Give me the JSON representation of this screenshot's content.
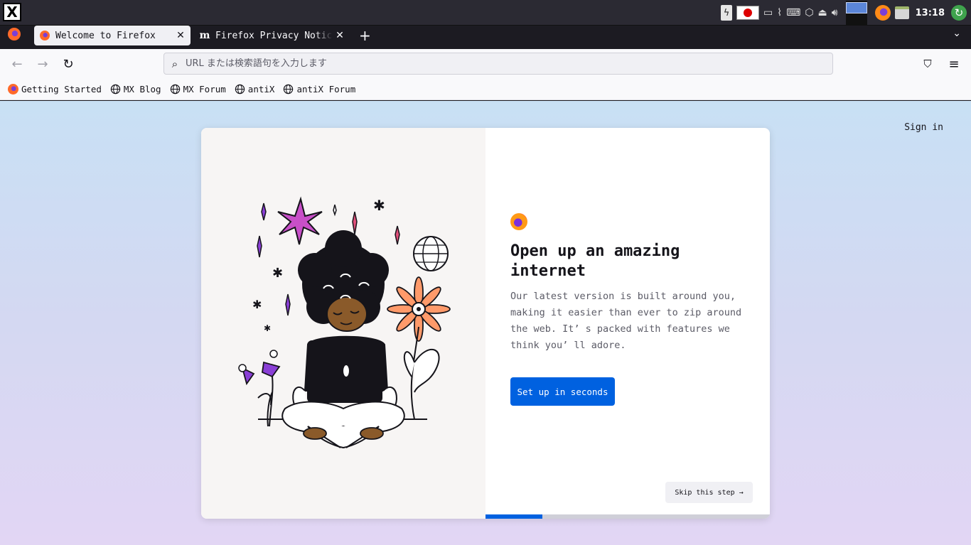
{
  "taskbar": {
    "logo_glyph": "X",
    "clock": "13:18",
    "tray_icons": [
      "power-icon",
      "flag-icon",
      "window-icon",
      "clip-icon",
      "keyboard-icon",
      "box-icon",
      "eject-icon",
      "volume-icon",
      "workspace-icon",
      "firefox-icon",
      "folder-icon",
      "update-icon"
    ]
  },
  "tabs": {
    "items": [
      {
        "title": "Welcome to Firefox",
        "close": "✕",
        "active": true
      },
      {
        "title": "Firefox Privacy Notice — ",
        "close": "✕",
        "active": false
      }
    ],
    "new_tab": "+",
    "list_all": "⌄"
  },
  "navbar": {
    "back": "←",
    "forward": "→",
    "reload": "↻",
    "url_placeholder": "URL または検索語句を入力します",
    "pocket": "⛉",
    "menu": "≡"
  },
  "bookmarks": [
    {
      "label": "Getting Started",
      "icon": "firefox-icon"
    },
    {
      "label": "MX Blog",
      "icon": "globe-icon"
    },
    {
      "label": "MX Forum",
      "icon": "globe-icon"
    },
    {
      "label": "antiX",
      "icon": "globe-icon"
    },
    {
      "label": "antiX Forum",
      "icon": "globe-icon"
    }
  ],
  "page": {
    "sign_in": "Sign in",
    "heading": "Open up an amazing internet",
    "subtitle": "Our latest version is built around you, making it easier than ever to zip around the web. It’ s packed with features we think you’ ll adore.",
    "primary_button": "Set up in seconds",
    "skip_button": "Skip this step →",
    "progress": 0.2
  },
  "colors": {
    "accent": "#0061e0",
    "tab_active_bg": "#f0f0f4",
    "toolbar_bg": "#f9f9fb",
    "chrome_dark": "#1c1b22"
  }
}
